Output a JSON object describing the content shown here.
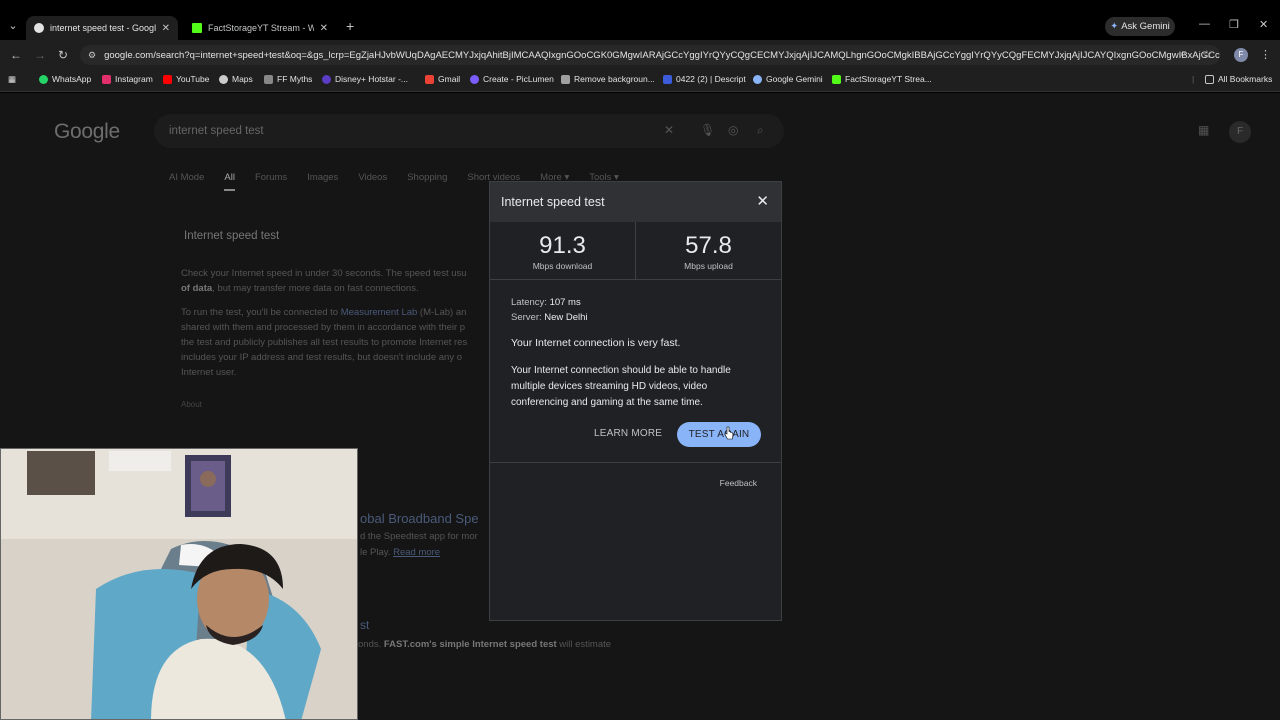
{
  "browser": {
    "tabs": [
      {
        "title": "internet speed test - Google Se",
        "active": true,
        "favicon_color": "#e3e3e3"
      },
      {
        "title": "FactStorageYT Stream - Watch",
        "active": false,
        "favicon_color": "#53fc18"
      }
    ],
    "ask_gemini": "Ask Gemini",
    "url": "google.com/search?q=internet+speed+test&oq=&gs_lcrp=EgZjaHJvbWUqDAgAECMYJxjqAhitBjIMCAAQIxgnGOoCGK0GMgwIARAjGCcYggIYrQYyCQgCECMYJxjqAjIJCAMQLhgnGOoCMgkIBBAjGCcYggIYrQYyCQgFECMYJxjqAjIJCAYQIxgnGOoCMgwIBxAjGCcYggIYrQYyDAgIECMYJxjqAhitBtIBCTkwOTZqMGoxNagCCLACAfEF",
    "profile_initial": "F",
    "bookmarks": [
      {
        "label": "WhatsApp",
        "color": "#25d366"
      },
      {
        "label": "Instagram",
        "color": "#e1306c"
      },
      {
        "label": "YouTube",
        "color": "#ff0000"
      },
      {
        "label": "Maps",
        "color": "#cccccc"
      },
      {
        "label": "FF Myths",
        "color": "#888888"
      },
      {
        "label": "Disney+ Hotstar -...",
        "color": "#5b3cc4"
      },
      {
        "label": "Gmail",
        "color": "#ea4335"
      },
      {
        "label": "Create - PicLumen",
        "color": "#7b5cff"
      },
      {
        "label": "Remove backgroun...",
        "color": "#a0a0a0"
      },
      {
        "label": "0422 (2) | Descript",
        "color": "#3b5bdb"
      },
      {
        "label": "Google Gemini",
        "color": "#8ab4f8"
      },
      {
        "label": "FactStorageYT Strea...",
        "color": "#53fc18"
      }
    ],
    "all_bookmarks": "All Bookmarks"
  },
  "google": {
    "logo": "Google",
    "query": "internet speed test",
    "avatar": "F",
    "tabs": [
      "AI Mode",
      "All",
      "Forums",
      "Images",
      "Videos",
      "Shopping",
      "Short videos",
      "More ▾",
      "Tools ▾"
    ],
    "card_heading": "Internet speed test",
    "para1_a": "Check your Internet speed in under 30 seconds. The speed test usu",
    "para1_b": "of data",
    "para1_c": ", but may transfer more data on fast connections.",
    "para2_a": "To run the test, you'll be connected to ",
    "para2_link": "Measurement Lab",
    "para2_b": " (M-Lab) an",
    "para2_lines": [
      "shared with them and processed by them in accordance with their p",
      "the test and publicly publishes all test results to promote Internet res",
      "includes your IP address and test results, but doesn't include any o",
      "Internet user."
    ],
    "about": "About",
    "broadband": "obal Broadband Spe",
    "bb_line1": "d the Speedtest app for mor",
    "bb_line2_a": "le Play. ",
    "bb_line2_link": "Read more",
    "fast_line_a": "onds. ",
    "fast_line_b": "FAST.com's simple Internet speed test",
    "fast_line_c": " will estimate",
    "bb_fragment": "st"
  },
  "dialog": {
    "title": "Internet speed test",
    "download_value": "91.3",
    "download_label": "Mbps download",
    "upload_value": "57.8",
    "upload_label": "Mbps upload",
    "latency_label": "Latency:",
    "latency_value": "107 ms",
    "server_label": "Server:",
    "server_value": "New Delhi",
    "verdict": "Your Internet connection is very fast.",
    "description": "Your Internet connection should be able to handle multiple devices streaming HD videos, video conferencing and gaming at the same time.",
    "learn_more": "LEARN MORE",
    "test_again": "TEST AGAIN",
    "feedback": "Feedback"
  }
}
